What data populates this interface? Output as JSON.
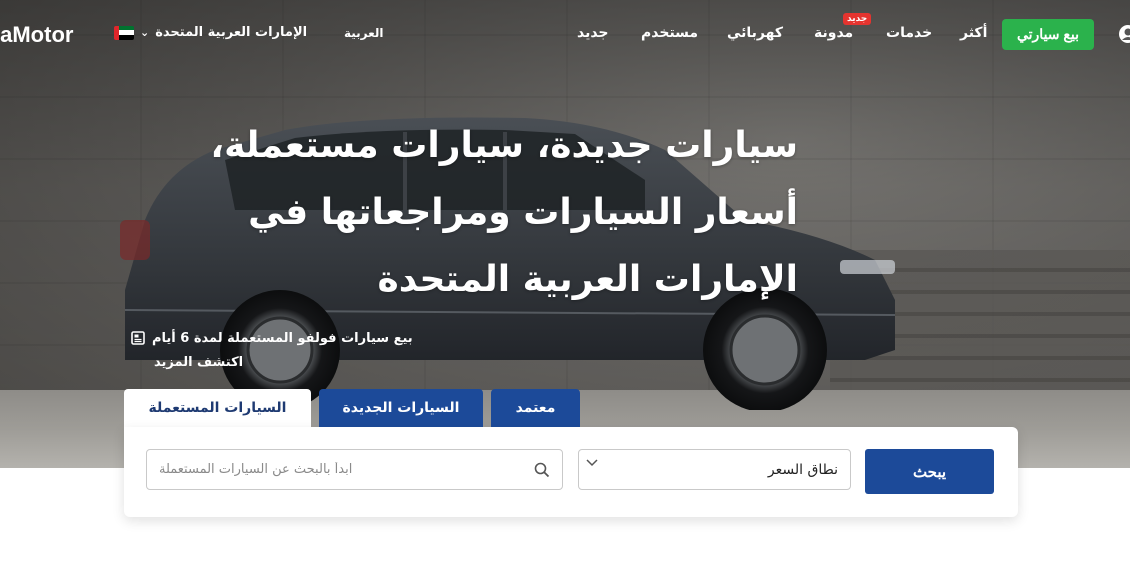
{
  "nav": {
    "logo_text": "laMotor",
    "country": "الإمارات العربية المتحدة",
    "language": "العربية",
    "links": {
      "new": "جديد",
      "used": "مستخدم",
      "electric": "كهربائي",
      "blog": "مدونة",
      "services": "خدمات",
      "more": "أكثر"
    },
    "blog_badge": "جديد",
    "sell_button": "بيع سيارتي",
    "flag_colors": {
      "red": "#e0262b",
      "green": "#00732f",
      "white": "#ffffff",
      "black": "#000000"
    }
  },
  "hero": {
    "headline": "سيارات جديدة، سيارات مستعملة، أسعار السيارات ومراجعاتها في الإمارات العربية المتحدة",
    "promo_text": "بيع سيارات فولفو المستعملة لمدة 6 أيام",
    "promo_link": "اكتشف المزيد"
  },
  "search": {
    "tabs": {
      "used": "السيارات المستعملة",
      "new": "السيارات الجديدة",
      "certified": "معتمد"
    },
    "input_placeholder": "ابدأ بالبحث عن السيارات المستعملة",
    "price_range": "نطاق السعر",
    "search_button": "يبحث"
  },
  "colors": {
    "primary_blue": "#1c4a99",
    "sell_green": "#2bb24c",
    "badge_red": "#e5342f"
  }
}
